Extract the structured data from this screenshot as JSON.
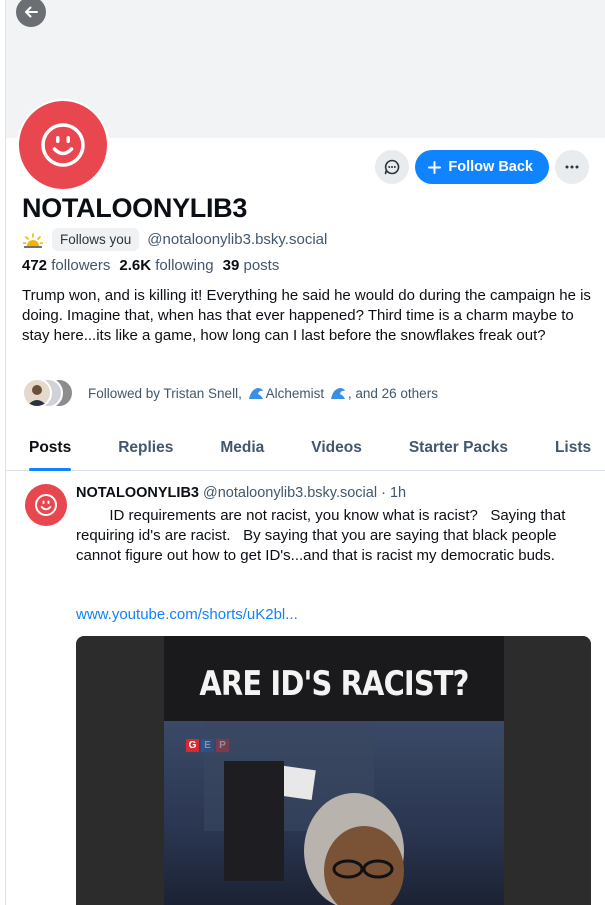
{
  "profile": {
    "display_name": "NOTALOONYLIB3",
    "follows_you": "Follows you",
    "handle": "@notaloonylib3.bsky.social",
    "avatar_icon": "smiley-face-icon",
    "avatar_color": "#e9474f",
    "accent_color": "#1083fe"
  },
  "actions": {
    "message_icon": "chat-bubble-icon",
    "follow_back": "Follow Back",
    "more_icon": "ellipsis-icon"
  },
  "stats": {
    "followers_count": "472",
    "followers_label": "followers",
    "following_count": "2.6K",
    "following_label": "following",
    "posts_count": "39",
    "posts_label": "posts"
  },
  "bio": "Trump won, and is killing it!  Everything he said he would do during the campaign he is doing.  Imagine that, when has that ever happened?   Third time is a charm maybe to stay here...its like a game, how long can I last before the snowflakes freak out?",
  "followed_by": {
    "prefix": "Followed by Tristan Snell,",
    "name2": "Alchemist",
    "suffix": ", and 26 others"
  },
  "tabs": [
    {
      "label": "Posts",
      "active": true
    },
    {
      "label": "Replies",
      "active": false
    },
    {
      "label": "Media",
      "active": false
    },
    {
      "label": "Videos",
      "active": false
    },
    {
      "label": "Starter Packs",
      "active": false
    },
    {
      "label": "Lists",
      "active": false
    }
  ],
  "post": {
    "author": "NOTALOONYLIB3",
    "handle": "@notaloonylib3.bsky.social",
    "time": "· 1h",
    "text": "        ID requirements are not racist, you know what is racist?   Saying that requiring id's are racist.   By saying that you are saying that black people cannot figure out how to get ID's...and that is racist my democratic buds.",
    "link": "www.youtube.com/shorts/uK2bl...",
    "video_title": "ARE ID'S RACIST?",
    "video_logo": "GEP"
  }
}
